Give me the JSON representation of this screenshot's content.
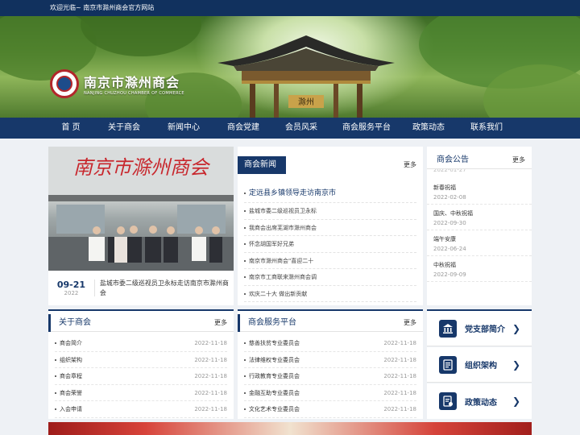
{
  "top_bar": {
    "welcome": "欢迎光临~ 南京市滁州商会官方网站"
  },
  "logo": {
    "name_cn": "南京市滁州商会",
    "name_en": "NANJING CHUZHOU CHAMBER OF COMMERCE"
  },
  "nav": {
    "items": [
      "首 页",
      "关于商会",
      "新闻中心",
      "商会党建",
      "会员风采",
      "商会服务平台",
      "政策动态",
      "联系我们"
    ]
  },
  "banner_sign": "滁州",
  "feature": {
    "image_sign": "南京市滁州商会",
    "date_md": "09-21",
    "date_year": "2022",
    "title": "盐城市委二级巡视员卫永标走访南京市滁州商会"
  },
  "news": {
    "title": "商会新闻",
    "more": "更多",
    "items": [
      "定远县乡镇领导走访南京市",
      "盐城市委二级巡视员卫永标",
      "我商会出席芜湖市滁州商会",
      "怀念胡国军好兄弟",
      "南京市滁州商会\"喜迎二十",
      "南京市工商联来滁州商会调",
      "欢庆二十大 做出新贡献"
    ]
  },
  "announcements": {
    "title": "商会公告",
    "more": "更多",
    "partial_date": "2022-01-27",
    "items": [
      {
        "title": "新春祝福",
        "date": "2022-02-08"
      },
      {
        "title": "国庆、中秋祝福",
        "date": "2022-09-30"
      },
      {
        "title": "端午安康",
        "date": "2022-06-24"
      },
      {
        "title": "中秋祝福",
        "date": "2022-09-09"
      }
    ]
  },
  "about": {
    "title": "关于商会",
    "more": "更多",
    "items": [
      {
        "title": "商会简介",
        "date": "2022-11-18"
      },
      {
        "title": "组织架构",
        "date": "2022-11-18"
      },
      {
        "title": "商会章程",
        "date": "2022-11-18"
      },
      {
        "title": "商会荣誉",
        "date": "2022-11-18"
      },
      {
        "title": "入会申请",
        "date": "2022-11-18"
      }
    ]
  },
  "service": {
    "title": "商会服务平台",
    "more": "更多",
    "items": [
      {
        "title": "慈善扶贫专业委员会",
        "date": "2022-11-18"
      },
      {
        "title": "法律维权专业委员会",
        "date": "2022-11-18"
      },
      {
        "title": "行政教育专业委员会",
        "date": "2022-11-18"
      },
      {
        "title": "金融互助专业委员会",
        "date": "2022-11-18"
      },
      {
        "title": "文化艺术专业委员会",
        "date": "2022-11-18"
      }
    ]
  },
  "quick_links": [
    {
      "label": "党支部简介",
      "icon": "building-icon"
    },
    {
      "label": "组织架构",
      "icon": "org-chart-icon"
    },
    {
      "label": "政策动态",
      "icon": "policy-icon"
    }
  ],
  "colors": {
    "primary": "#17386a",
    "top_bar": "#11315e",
    "page_bg": "#eef1f5",
    "seal_red": "#b3262b"
  }
}
